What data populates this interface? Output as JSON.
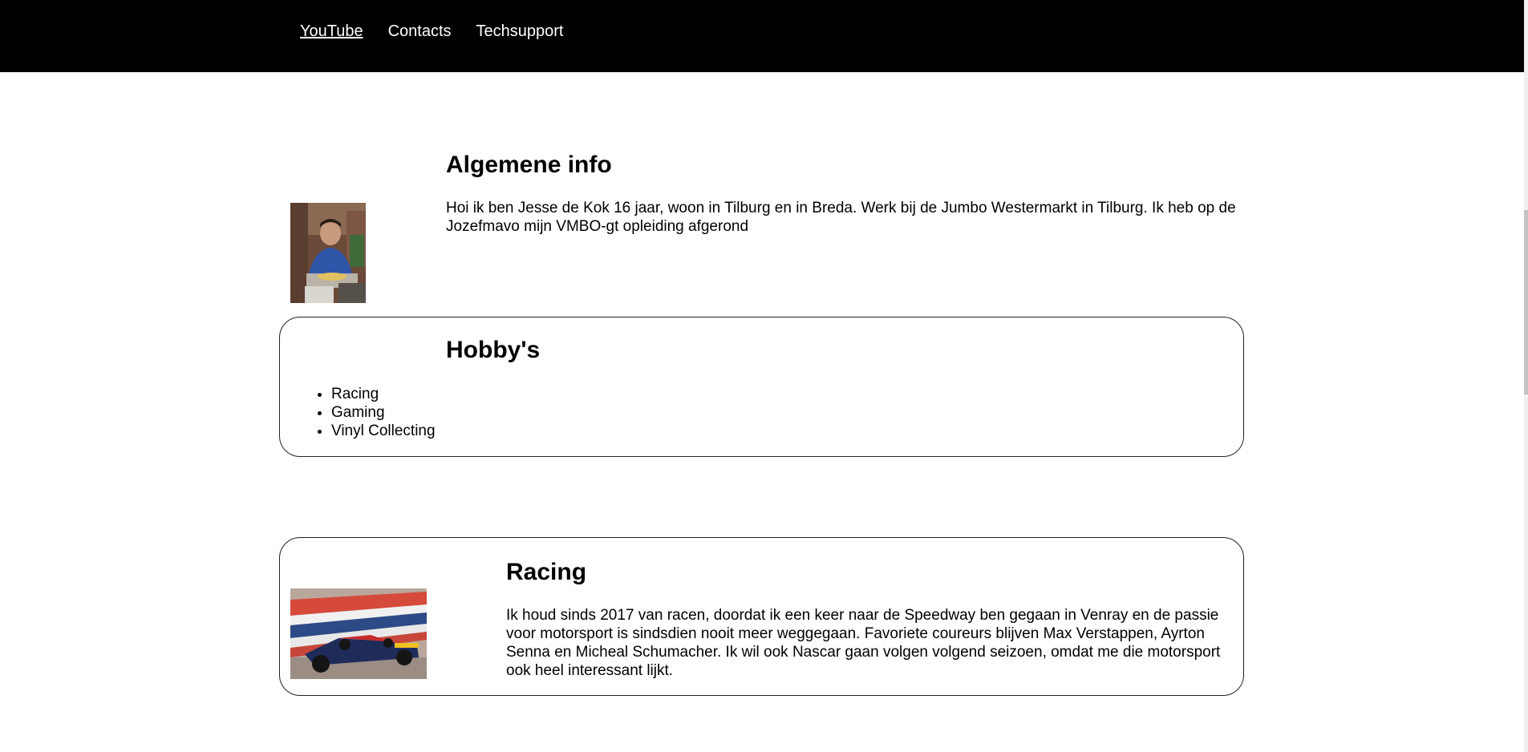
{
  "nav": {
    "items": [
      {
        "label": "YouTube",
        "active": true
      },
      {
        "label": "Contacts",
        "active": false
      },
      {
        "label": "Techsupport",
        "active": false
      }
    ]
  },
  "info": {
    "title": "Algemene info",
    "text": "Hoi ik ben Jesse de Kok 16 jaar, woon in Tilburg en in Breda. Werk bij de Jumbo Westermarkt in Tilburg. Ik heb op de Jozefmavo mijn VMBO-gt opleiding afgerond"
  },
  "hobbies": {
    "title": "Hobby's",
    "items": [
      "Racing",
      "Gaming",
      "Vinyl Collecting"
    ]
  },
  "racing": {
    "title": "Racing",
    "text": "Ik houd sinds 2017 van racen, doordat ik een keer naar de Speedway ben gegaan in Venray en de passie voor motorsport is sindsdien nooit meer weggegaan. Favoriete coureurs blijven Max Verstappen, Ayrton Senna en Micheal Schumacher. Ik wil ook Nascar gaan volgen volgend seizoen, omdat me die motorsport ook heel interessant lijkt."
  }
}
